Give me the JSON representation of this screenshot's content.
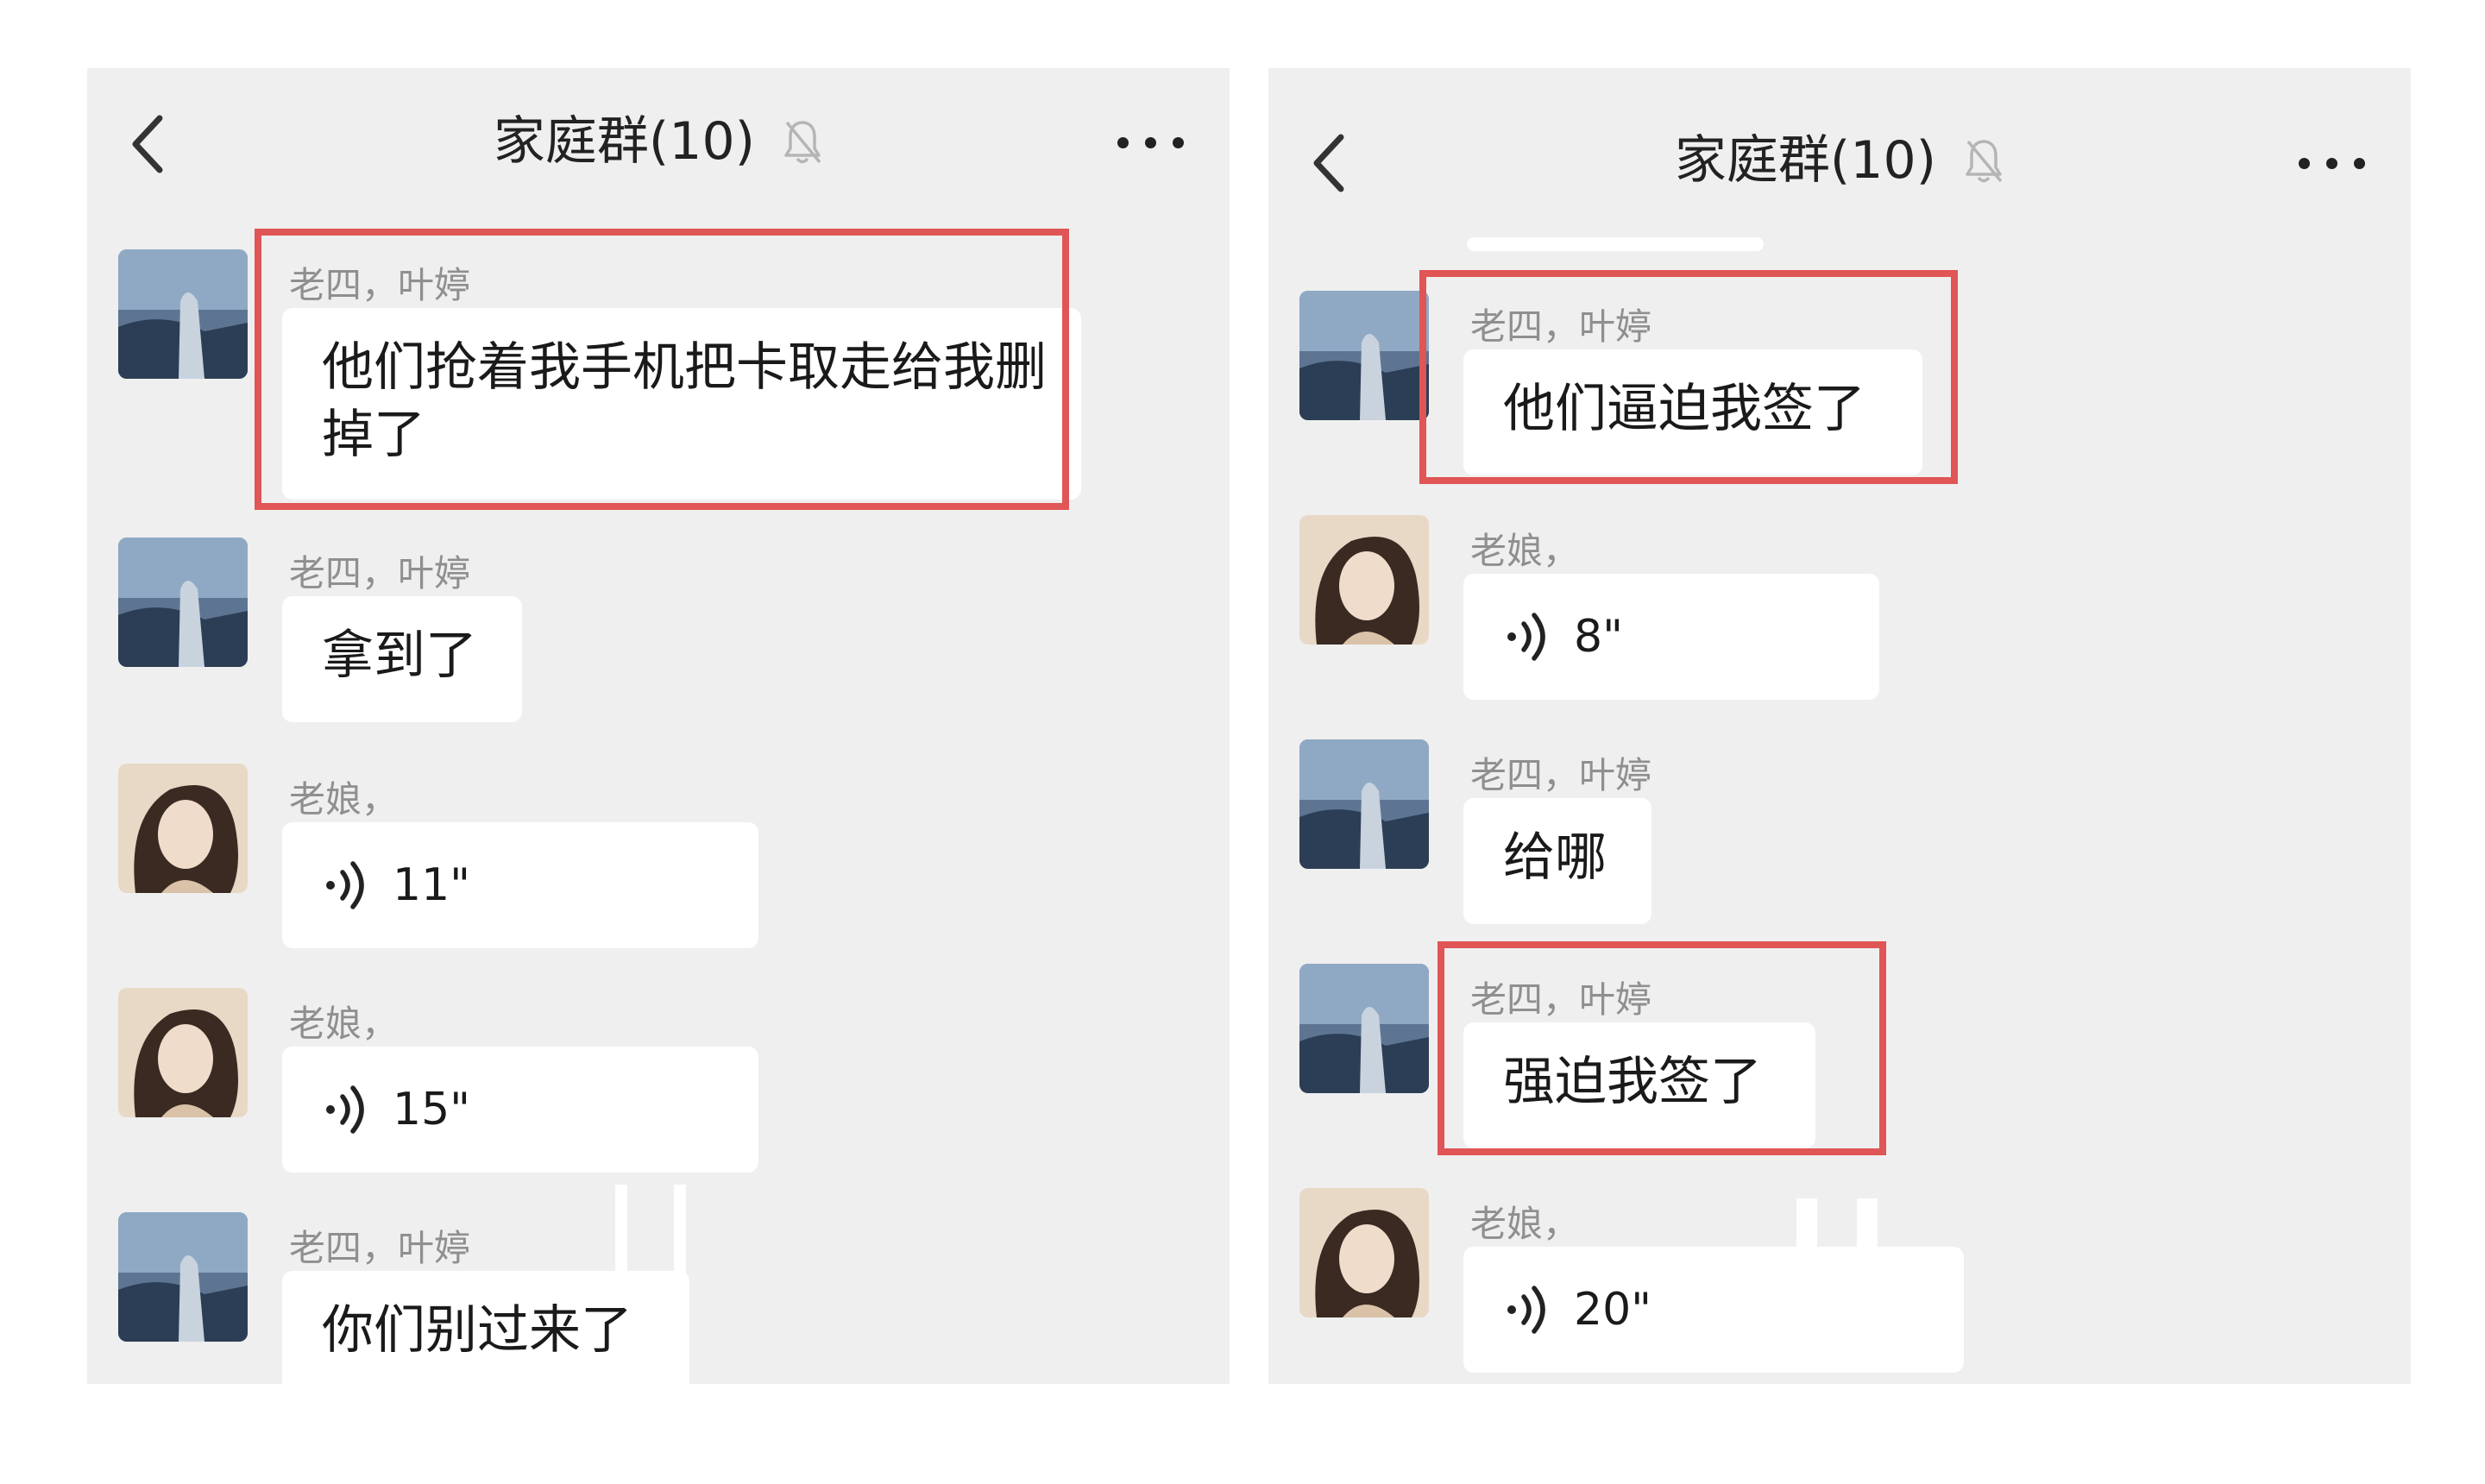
{
  "left": {
    "title": "家庭群(10)",
    "messages": [
      {
        "sender": "老四，叶婷",
        "text": "他们抢着我手机把卡取走给我删掉了"
      },
      {
        "sender": "老四，叶婷",
        "text": "拿到了"
      },
      {
        "sender": "老娘，",
        "voice": "11\""
      },
      {
        "sender": "老娘，",
        "voice": "15\""
      },
      {
        "sender": "老四，叶婷",
        "text": "你们别过来了"
      }
    ]
  },
  "right": {
    "title": "家庭群(10)",
    "messages": [
      {
        "sender": "老四，叶婷",
        "text": "他们逼迫我签了"
      },
      {
        "sender": "老娘，",
        "voice": "8\""
      },
      {
        "sender": "老四，叶婷",
        "text": "给哪"
      },
      {
        "sender": "老四，叶婷",
        "text": "强迫我签了"
      },
      {
        "sender": "老娘，",
        "voice": "20\""
      }
    ]
  },
  "icons": {
    "back": "chevron-left-icon",
    "mute": "bell-off-icon",
    "more": "more-dots-icon",
    "voice": "voice-wave-icon"
  },
  "colors": {
    "panel_bg": "#efefef",
    "bubble_bg": "#ffffff",
    "highlight": "#e05555"
  }
}
